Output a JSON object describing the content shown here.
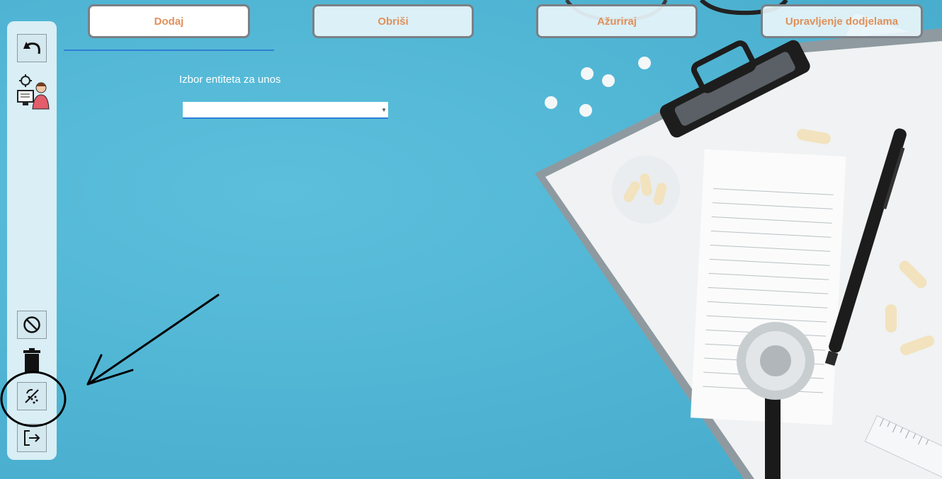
{
  "toolbar": {
    "buttons": [
      {
        "label": "Dodaj"
      },
      {
        "label": "Obriši"
      },
      {
        "label": "Ažuriraj"
      },
      {
        "label": "Upravljenje dodjelama"
      }
    ]
  },
  "main": {
    "entity_label": "Izbor entiteta za unos",
    "entity_select_value": ""
  },
  "sidebar": {
    "icons": [
      "undo-icon",
      "admin-user-icon",
      "block-icon",
      "trash-icon",
      "disable-icon",
      "logout-icon"
    ]
  },
  "colors": {
    "accent": "#e0905a",
    "underline": "#2f7fd6",
    "background": "#4fb4d3",
    "sidebar": "#d9eef5"
  }
}
